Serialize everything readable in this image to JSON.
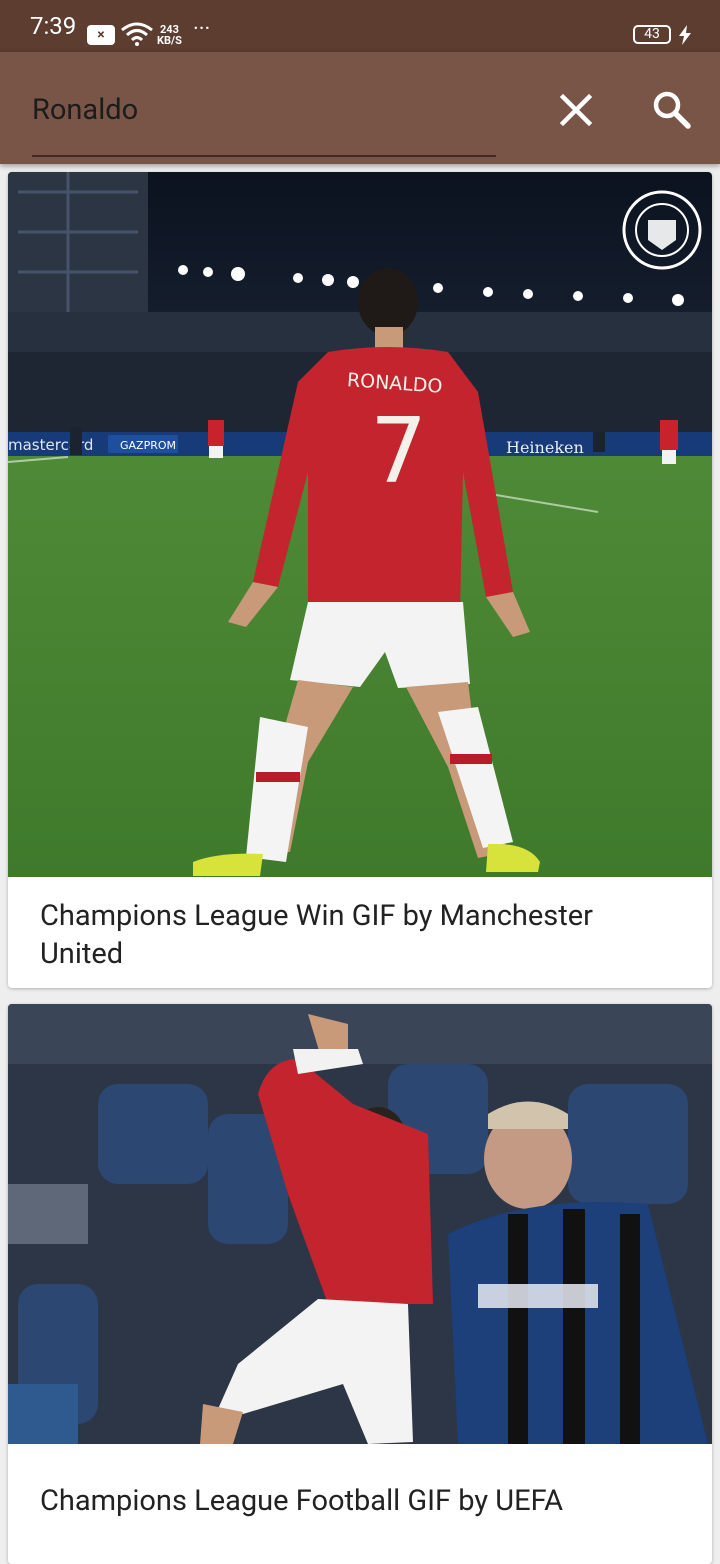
{
  "status_bar": {
    "time": "7:39",
    "notification_icon": "x-box-icon",
    "network_speed_value": "243",
    "network_speed_unit": "KB/S",
    "overflow": "···",
    "battery_level": "43"
  },
  "app_bar": {
    "search_value": "Ronaldo",
    "clear_icon": "close-icon",
    "search_icon": "search-icon",
    "background_color": "#795548"
  },
  "results": [
    {
      "title": "Champions League Win GIF by Manchester United",
      "jersey_name": "RONALDO",
      "jersey_number": "7",
      "ad_board_1": "Heineken",
      "ad_board_2": "GAZPROM",
      "ad_board_3": "mastercard"
    },
    {
      "title": "Champions League Football GIF by UEFA"
    }
  ]
}
